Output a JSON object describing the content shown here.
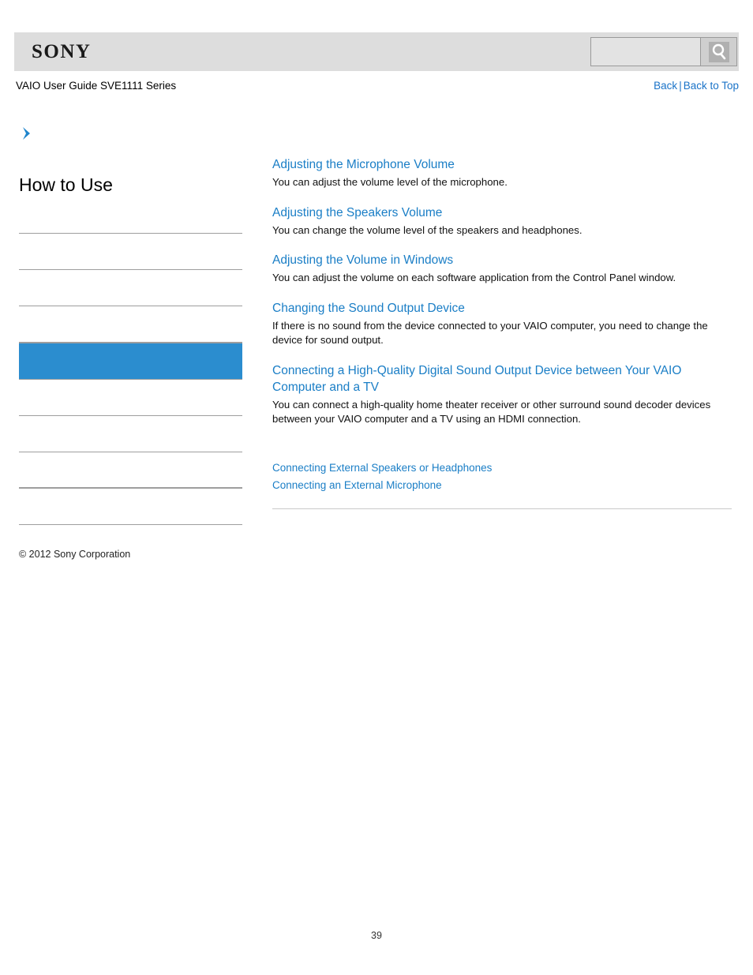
{
  "header": {
    "logo_text": "SONY",
    "search": {
      "value": "",
      "placeholder": "",
      "icon": "search-icon"
    }
  },
  "subheader": {
    "guide_title": "VAIO User Guide SVE1111 Series",
    "back_label": "Back",
    "separator": "|",
    "back_to_top_label": "Back to Top"
  },
  "sidebar": {
    "arrow_icon": "chevron-right-icon",
    "title": "How to Use",
    "active_color": "#2b8dcf",
    "items": [
      {
        "label": "",
        "active": false
      },
      {
        "label": "",
        "active": false
      },
      {
        "label": "",
        "active": false
      },
      {
        "label": "",
        "active": false
      },
      {
        "label": "",
        "active": true
      },
      {
        "label": "",
        "active": false
      },
      {
        "label": "",
        "active": false
      },
      {
        "label": "",
        "active": false
      },
      {
        "label": "",
        "active": false
      }
    ],
    "copyright": "© 2012 Sony Corporation"
  },
  "main": {
    "topics": [
      {
        "title": "Adjusting the Microphone Volume",
        "description": "You can adjust the volume level of the microphone."
      },
      {
        "title": "Adjusting the Speakers Volume",
        "description": "You can change the volume level of the speakers and headphones."
      },
      {
        "title": "Adjusting the Volume in Windows",
        "description": "You can adjust the volume on each software application from the Control Panel window."
      },
      {
        "title": "Changing the Sound Output Device",
        "description": "If there is no sound from the device connected to your VAIO computer, you need to change the device for sound output."
      },
      {
        "title": "Connecting a High-Quality Digital Sound Output Device between Your VAIO Computer and a TV",
        "description": "You can connect a high-quality home theater receiver or other surround sound decoder devices between your VAIO computer and a TV using an HDMI connection."
      }
    ],
    "related_links": [
      "Connecting External Speakers or Headphones",
      "Connecting an External Microphone"
    ]
  },
  "footer": {
    "page_number": "39"
  },
  "colors": {
    "link": "#1a7ec6",
    "nav_link": "#1a73c8",
    "highlight": "#2b8dcf",
    "header_bg": "#dddddd"
  }
}
